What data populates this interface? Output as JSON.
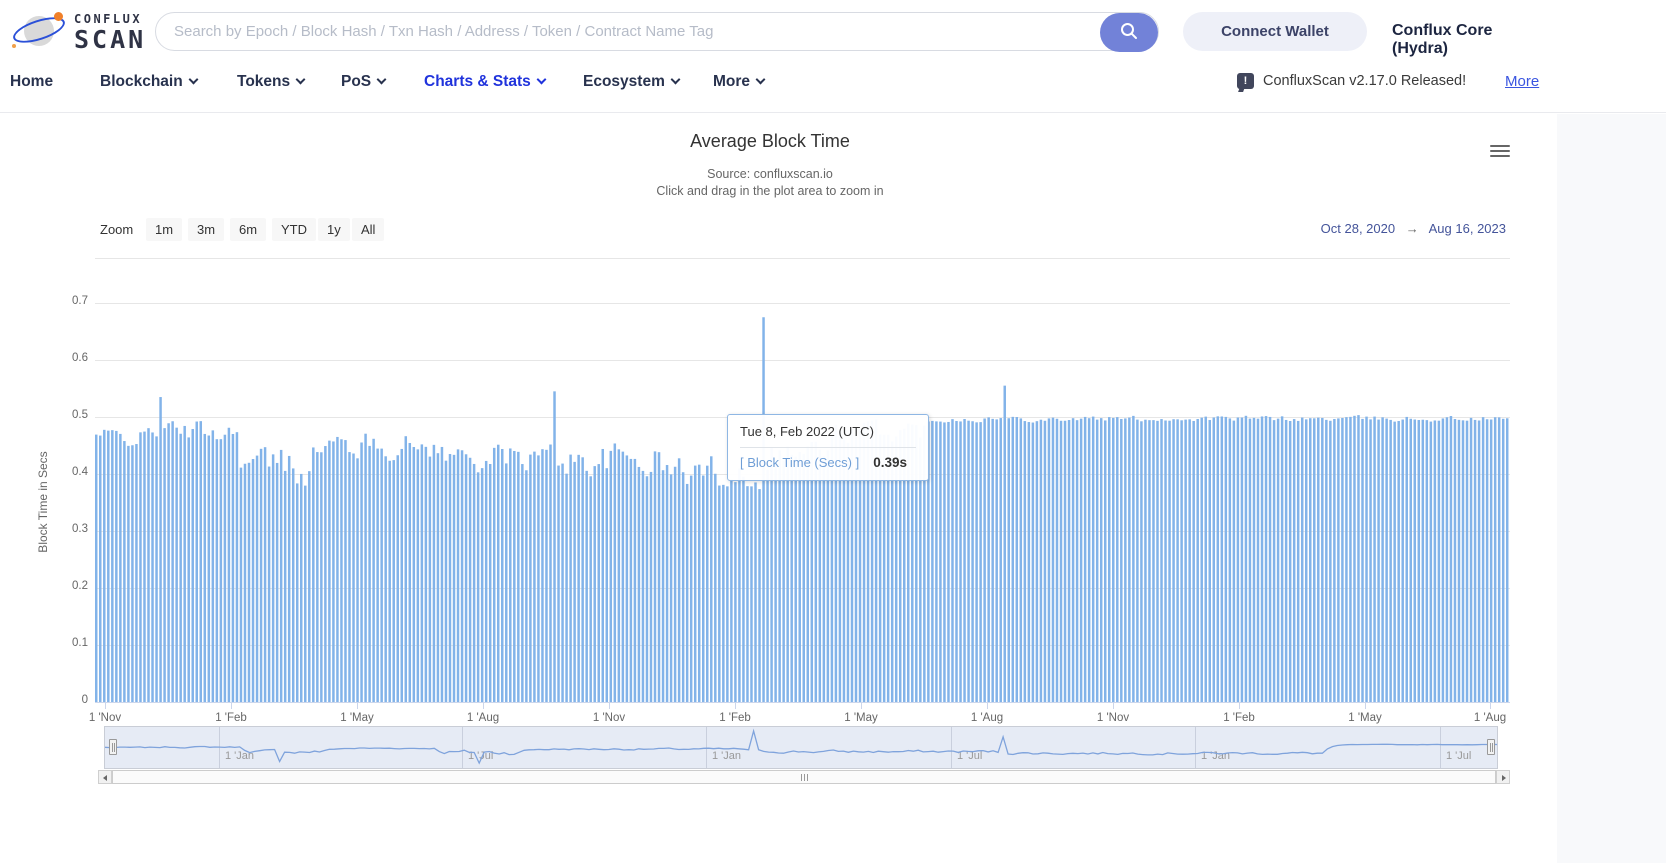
{
  "header": {
    "logo": {
      "line1": "CONFLUX",
      "line2": "SCAN"
    },
    "search": {
      "placeholder": "Search by Epoch / Block Hash / Txn Hash / Address / Token / Contract Name Tag"
    },
    "connect_wallet_label": "Connect Wallet",
    "network_label": "Conflux Core (Hydra)"
  },
  "nav": {
    "items": [
      {
        "label": "Home"
      },
      {
        "label": "Blockchain"
      },
      {
        "label": "Tokens"
      },
      {
        "label": "PoS"
      },
      {
        "label": "Charts & Stats"
      },
      {
        "label": "Ecosystem"
      },
      {
        "label": "More"
      }
    ],
    "announcement": {
      "text": "ConfluxScan v2.17.0 Released!",
      "more_label": "More"
    }
  },
  "chart": {
    "title": "Average Block Time",
    "subtitle1": "Source: confluxscan.io",
    "subtitle2": "Click and drag in the plot area to zoom in",
    "range_selector": {
      "zoom_label": "Zoom",
      "buttons": [
        "1m",
        "3m",
        "6m",
        "YTD",
        "1y",
        "All"
      ],
      "from": "Oct 28, 2020",
      "separator": "→",
      "to": "Aug 16, 2023"
    },
    "tooltip": {
      "title": "Tue 8, Feb 2022 (UTC)",
      "series_label": "[ Block Time (Secs) ]",
      "value": "0.39s"
    },
    "yaxis": {
      "title": "Block Time in Secs",
      "ticks": [
        "0.7",
        "0.6",
        "0.5",
        "0.4",
        "0.3",
        "0.2",
        "0.1",
        "0"
      ]
    },
    "xaxis": {
      "ticks": [
        "1 'Nov",
        "1 'Feb",
        "1 'May",
        "1 'Aug",
        "1 'Nov",
        "1 'Feb",
        "1 'May",
        "1 'Aug",
        "1 'Nov",
        "1 'Feb",
        "1 'May",
        "1 'Aug"
      ]
    },
    "navigator": {
      "ticks": [
        "1 'Jan",
        "1 'Jul",
        "1 'Jan",
        "1 'Jul",
        "1 'Jan",
        "1 'Jul"
      ]
    }
  },
  "chart_data": {
    "type": "column",
    "title": "Average Block Time",
    "ylabel": "Block Time in Secs",
    "ylim": [
      0,
      0.75
    ],
    "yticks": [
      0,
      0.1,
      0.2,
      0.3,
      0.4,
      0.5,
      0.6,
      0.7
    ],
    "x_range": [
      "Oct 28, 2020",
      "Aug 16, 2023"
    ],
    "x_tick_labels": [
      "1 'Nov",
      "1 'Feb",
      "1 'May",
      "1 'Aug",
      "1 'Nov",
      "1 'Feb",
      "1 'May",
      "1 'Aug",
      "1 'Nov",
      "1 'Feb",
      "1 'May",
      "1 'Aug"
    ],
    "series": [
      {
        "name": "Block Time (Secs)",
        "unit": "s"
      }
    ],
    "hover_point": {
      "date": "Tue 8, Feb 2022 (UTC)",
      "value_secs": 0.39
    },
    "bar_color": "#82b3e9",
    "line_color": "#7fa3dc",
    "bar_count": 352,
    "main_profile": [
      {
        "from": 0.0,
        "to": 0.035,
        "base": 0.465,
        "amp": 0.025
      },
      {
        "from": 0.035,
        "to": 0.1,
        "base": 0.475,
        "amp": 0.03
      },
      {
        "from": 0.1,
        "to": 0.15,
        "base": 0.415,
        "amp": 0.055
      },
      {
        "from": 0.15,
        "to": 0.24,
        "base": 0.45,
        "amp": 0.035
      },
      {
        "from": 0.24,
        "to": 0.33,
        "base": 0.43,
        "amp": 0.04
      },
      {
        "from": 0.33,
        "to": 0.4,
        "base": 0.425,
        "amp": 0.045
      },
      {
        "from": 0.4,
        "to": 0.472,
        "base": 0.405,
        "amp": 0.045
      },
      {
        "from": 0.472,
        "to": 0.52,
        "base": 0.44,
        "amp": 0.05
      },
      {
        "from": 0.52,
        "to": 0.585,
        "base": 0.475,
        "amp": 0.03
      },
      {
        "from": 0.585,
        "to": 1.001,
        "base": 0.497,
        "amp": 0.008
      }
    ],
    "spikes": [
      {
        "pos": 0.045,
        "value": 0.535
      },
      {
        "pos": 0.3235,
        "value": 0.545
      },
      {
        "pos": 0.4717,
        "value": 0.675
      },
      {
        "pos": 0.645,
        "value": 0.555
      }
    ],
    "navigator_profile": [
      {
        "from": 0.0,
        "to": 0.035,
        "base": 0.47,
        "amp": 0.01
      },
      {
        "from": 0.035,
        "to": 0.1,
        "base": 0.475,
        "amp": 0.015
      },
      {
        "from": 0.1,
        "to": 0.16,
        "base": 0.42,
        "amp": 0.04
      },
      {
        "from": 0.16,
        "to": 0.24,
        "base": 0.46,
        "amp": 0.015
      },
      {
        "from": 0.24,
        "to": 0.3,
        "base": 0.41,
        "amp": 0.05
      },
      {
        "from": 0.3,
        "to": 0.46,
        "base": 0.45,
        "amp": 0.02
      },
      {
        "from": 0.46,
        "to": 0.64,
        "base": 0.42,
        "amp": 0.03
      },
      {
        "from": 0.64,
        "to": 0.875,
        "base": 0.4,
        "amp": 0.025
      },
      {
        "from": 0.875,
        "to": 1.001,
        "base": 0.505,
        "amp": 0.004
      }
    ],
    "navigator_spikes": [
      {
        "pos": 0.125,
        "value": 0.3
      },
      {
        "pos": 0.27,
        "value": 0.28
      },
      {
        "pos": 0.466,
        "value": 0.67
      },
      {
        "pos": 0.645,
        "value": 0.6
      }
    ]
  }
}
